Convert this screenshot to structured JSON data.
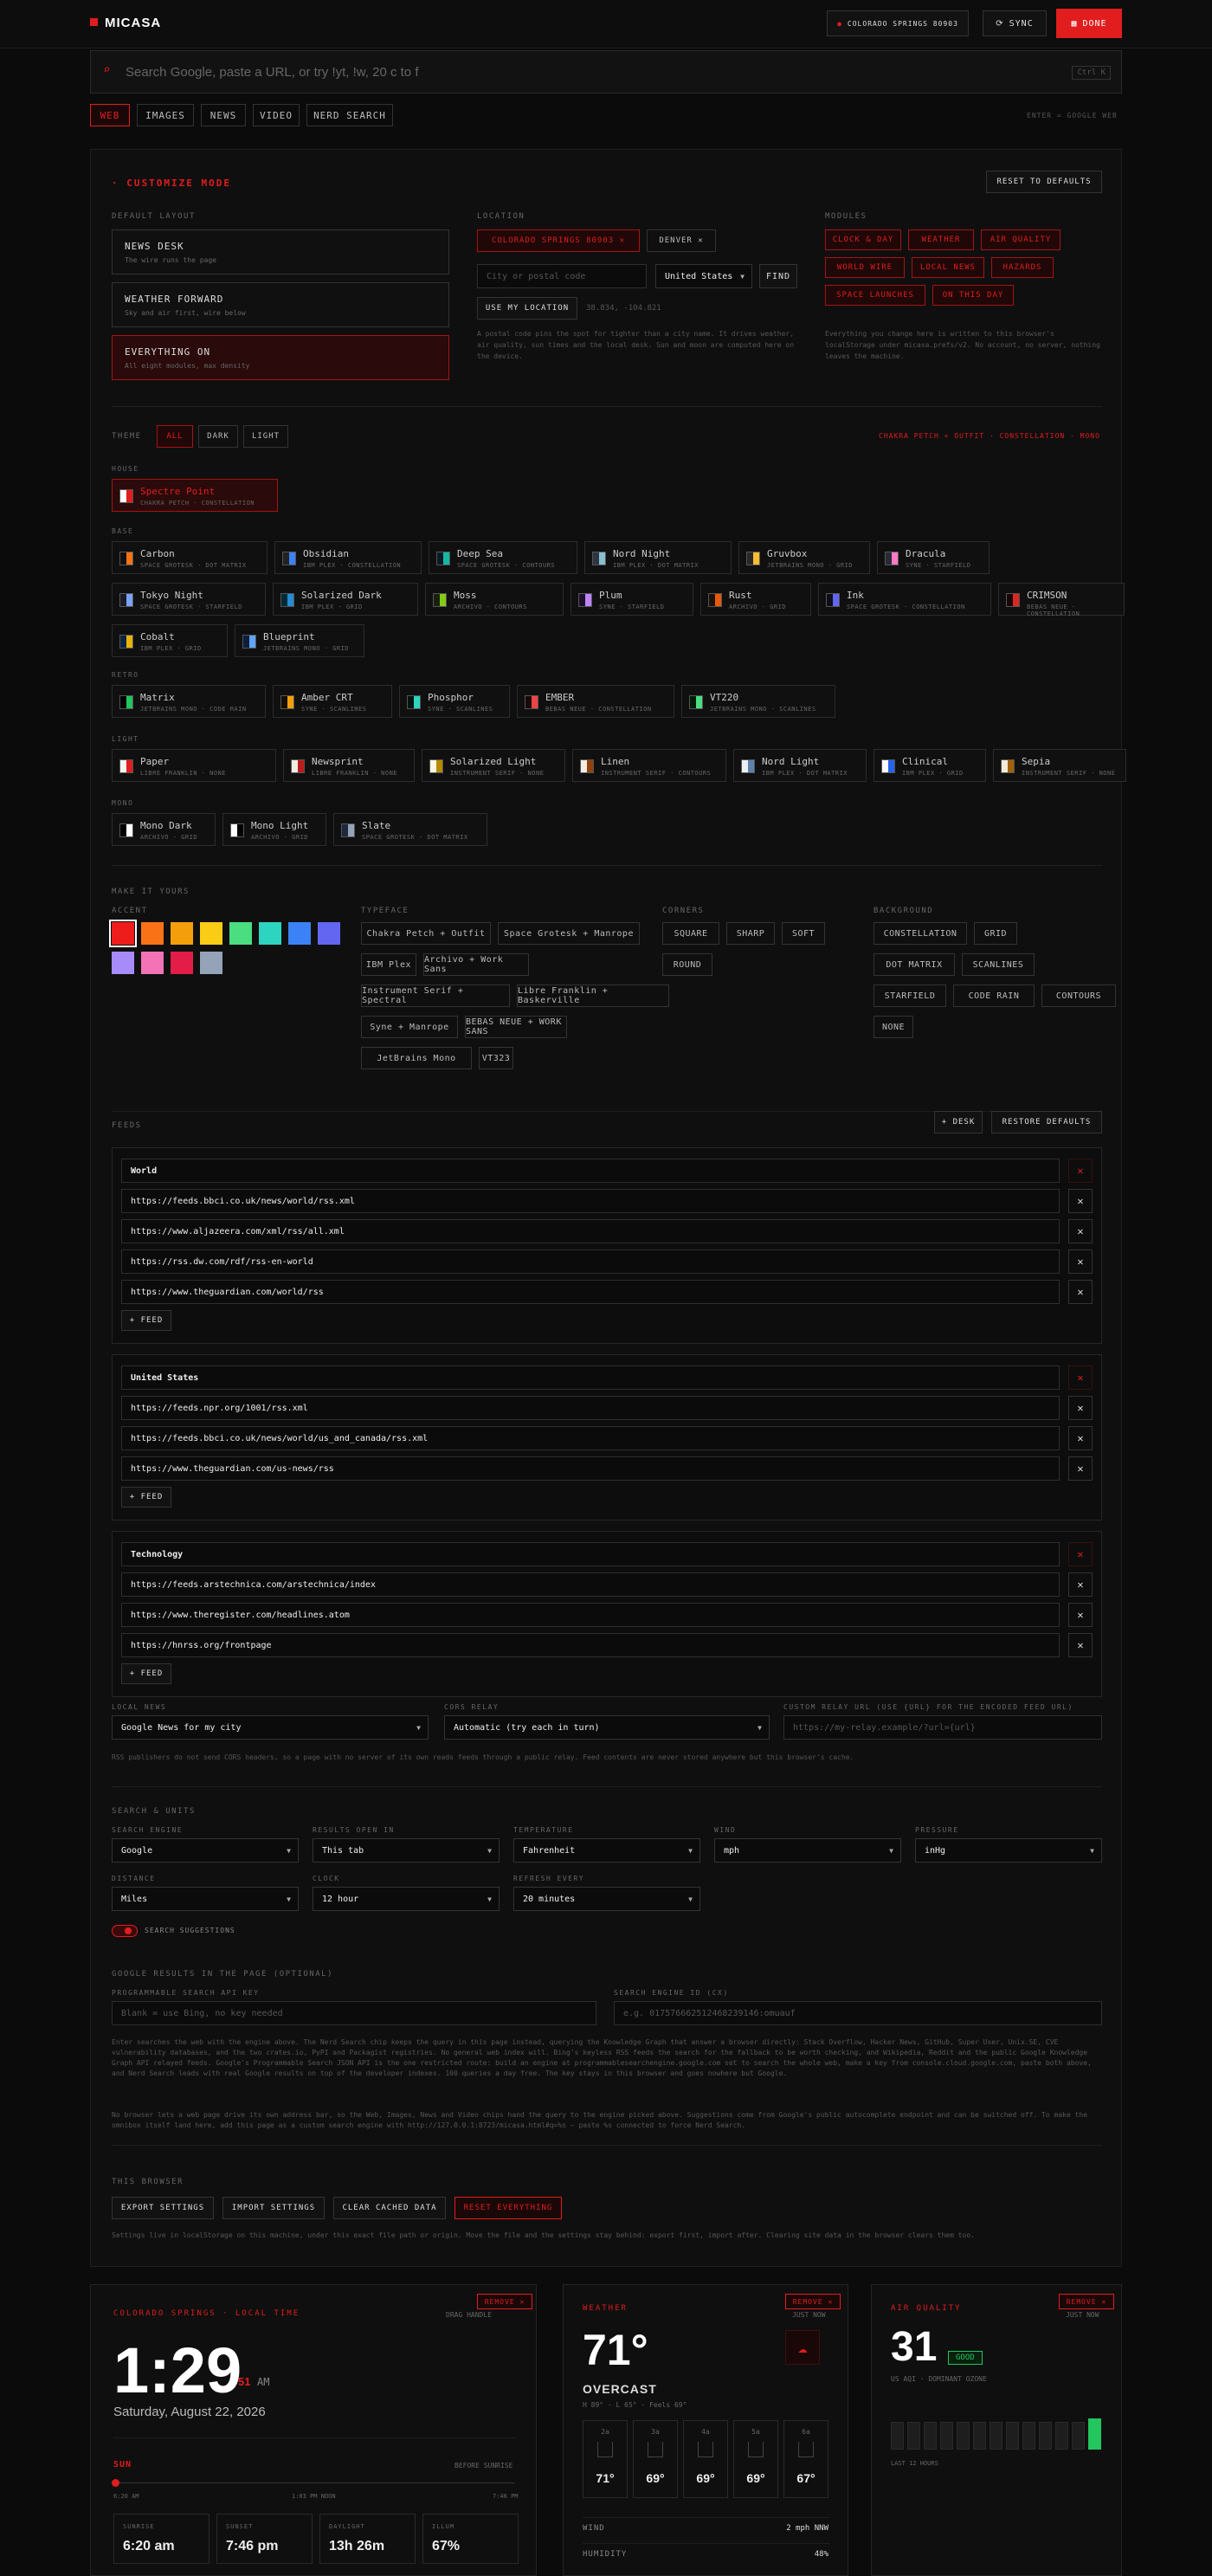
{
  "header": {
    "brand": "MICASA",
    "location": "COLORADO SPRINGS 80903",
    "sync": "SYNC",
    "done": "DONE"
  },
  "search": {
    "placeholder": "Search Google, paste a URL, or try !yt, !w, 20 c to f",
    "shortcut": "Ctrl K"
  },
  "tabs": [
    "WEB",
    "IMAGES",
    "NEWS",
    "VIDEO",
    "NERD SEARCH"
  ],
  "search_hint": "ENTER = GOOGLE WEB",
  "customize": {
    "title": "CUSTOMIZE MODE",
    "reset": "RESET TO DEFAULTS",
    "default_layout_label": "DEFAULT LAYOUT",
    "layouts": [
      {
        "title": "NEWS DESK",
        "sub": "The wire runs the page"
      },
      {
        "title": "WEATHER FORWARD",
        "sub": "Sky and air first, wire below"
      },
      {
        "title": "EVERYTHING ON",
        "sub": "All eight modules, max density"
      }
    ],
    "location_label": "LOCATION",
    "locations": [
      "COLORADO SPRINGS 80903",
      "DENVER"
    ],
    "city_placeholder": "City or postal code",
    "country": "United States",
    "find": "FIND",
    "use_location": "USE MY LOCATION",
    "coords": "38.834, -104.821",
    "location_note": "A postal code pins the spot for tighter than a city name. It drives weather, air quality, sun times and the local desk. Sun and moon are computed here on the device.",
    "modules_label": "MODULES",
    "modules": [
      "CLOCK & DAY",
      "WEATHER",
      "AIR QUALITY",
      "WORLD WIRE",
      "LOCAL NEWS",
      "HAZARDS",
      "SPACE LAUNCHES",
      "ON THIS DAY"
    ],
    "modules_note": "Everything you change here is written to this browser's localStorage under micasa.prefs/v2. No account, no server, nothing leaves the machine."
  },
  "theme": {
    "label": "THEME",
    "filters": [
      "ALL",
      "DARK",
      "LIGHT"
    ],
    "current": "CHAKRA PETCH + OUTFIT · CONSTELLATION · MONO",
    "house_label": "HOUSE",
    "house": [
      {
        "name": "Spectre Point",
        "desc": "CHAKRA PETCH · CONSTELLATION",
        "c1": "#e11d1d",
        "c2": "#ffffff"
      }
    ],
    "base_label": "BASE",
    "base": [
      {
        "name": "Carbon",
        "desc": "SPACE GROTESK · DOT MATRIX",
        "c1": "#f97316",
        "c2": "#111"
      },
      {
        "name": "Obsidian",
        "desc": "IBM PLEX · CONSTELLATION",
        "c1": "#3b82f6",
        "c2": "#222"
      },
      {
        "name": "Deep Sea",
        "desc": "SPACE GROTESK · CONTOURS",
        "c1": "#14b8a6",
        "c2": "#0c1a24"
      },
      {
        "name": "Nord Night",
        "desc": "IBM PLEX · DOT MATRIX",
        "c1": "#88c0d0",
        "c2": "#2e3440"
      },
      {
        "name": "Gruvbox",
        "desc": "JETBRAINS MONO · GRID",
        "c1": "#fabd2f",
        "c2": "#282828"
      },
      {
        "name": "Dracula",
        "desc": "SYNE · STARFIELD",
        "c1": "#ff79c6",
        "c2": "#282a36"
      },
      {
        "name": "Tokyo Night",
        "desc": "SPACE GROTESK · STARFIELD",
        "c1": "#7aa2f7",
        "c2": "#1a1b26"
      },
      {
        "name": "Solarized Dark",
        "desc": "IBM PLEX · GRID",
        "c1": "#268bd2",
        "c2": "#002b36"
      },
      {
        "name": "Moss",
        "desc": "ARCHIVO · CONTOURS",
        "c1": "#84cc16",
        "c2": "#1a2010"
      },
      {
        "name": "Plum",
        "desc": "SYNE · STARFIELD",
        "c1": "#c084fc",
        "c2": "#1e1028"
      },
      {
        "name": "Rust",
        "desc": "ARCHIVO · GRID",
        "c1": "#ea580c",
        "c2": "#1c1208"
      },
      {
        "name": "Ink",
        "desc": "SPACE GROTESK · CONSTELLATION",
        "c1": "#6366f1",
        "c2": "#0f0f1a"
      },
      {
        "name": "CRIMSON",
        "desc": "BEBAS NEUE · CONSTELLATION",
        "c1": "#dc2626",
        "c2": "#1a0606"
      },
      {
        "name": "Cobalt",
        "desc": "IBM PLEX · GRID",
        "c1": "#eab308",
        "c2": "#0b2540"
      },
      {
        "name": "Blueprint",
        "desc": "JETBRAINS MONO · GRID",
        "c1": "#60a5fa",
        "c2": "#0c1e3a"
      }
    ],
    "retro_label": "RETRO",
    "retro": [
      {
        "name": "Matrix",
        "desc": "JETBRAINS MONO · CODE RAIN",
        "c1": "#22c55e",
        "c2": "#000"
      },
      {
        "name": "Amber CRT",
        "desc": "SYNE · SCANLINES",
        "c1": "#f59e0b",
        "c2": "#140c00"
      },
      {
        "name": "Phosphor",
        "desc": "SYNE · SCANLINES",
        "c1": "#2dd4bf",
        "c2": "#001410"
      },
      {
        "name": "EMBER",
        "desc": "BEBAS NEUE · CONSTELLATION",
        "c1": "#ef4444",
        "c2": "#180808"
      },
      {
        "name": "VT220",
        "desc": "JETBRAINS MONO · SCANLINES",
        "c1": "#4ade80",
        "c2": "#031a08"
      }
    ],
    "light_label": "LIGHT",
    "light": [
      {
        "name": "Paper",
        "desc": "LIBRE FRANKLIN · NONE",
        "c1": "#e11d1d",
        "c2": "#f5f5f0"
      },
      {
        "name": "Newsprint",
        "desc": "LIBRE FRANKLIN · NONE",
        "c1": "#b91c1c",
        "c2": "#efece4"
      },
      {
        "name": "Solarized Light",
        "desc": "INSTRUMENT SERIF · NONE",
        "c1": "#b58900",
        "c2": "#fdf6e3"
      },
      {
        "name": "Linen",
        "desc": "INSTRUMENT SERIF · CONTOURS",
        "c1": "#92400e",
        "c2": "#f3ede2"
      },
      {
        "name": "Nord Light",
        "desc": "IBM PLEX · DOT MATRIX",
        "c1": "#5e81ac",
        "c2": "#eceff4"
      },
      {
        "name": "Clinical",
        "desc": "IBM PLEX · GRID",
        "c1": "#2563eb",
        "c2": "#fafafa"
      },
      {
        "name": "Sepia",
        "desc": "INSTRUMENT SERIF · NONE",
        "c1": "#a16207",
        "c2": "#f4ecd8"
      }
    ],
    "mono_label": "MONO",
    "mono": [
      {
        "name": "Mono Dark",
        "desc": "ARCHIVO · GRID",
        "c1": "#ffffff",
        "c2": "#000"
      },
      {
        "name": "Mono Light",
        "desc": "ARCHIVO · GRID",
        "c1": "#000000",
        "c2": "#fff"
      },
      {
        "name": "Slate",
        "desc": "SPACE GROTESK · DOT MATRIX",
        "c1": "#94a3b8",
        "c2": "#1e293b"
      }
    ]
  },
  "make_it_yours": {
    "label": "MAKE IT YOURS",
    "accent_label": "ACCENT",
    "accents": [
      "#ef1c1c",
      "#f97316",
      "#f59e0b",
      "#facc15",
      "#4ade80",
      "#2dd4bf",
      "#3b82f6",
      "#6366f1",
      "#a78bfa",
      "#f472b6",
      "#e11d48",
      "#94a3b8"
    ],
    "typeface_label": "TYPEFACE",
    "typefaces": [
      "Chakra Petch + Outfit",
      "Space Grotesk + Manrope",
      "IBM Plex",
      "Archivo + Work Sans",
      "Instrument Serif + Spectral",
      "Libre Franklin + Baskerville",
      "Syne + Manrope",
      "BEBAS NEUE + WORK SANS",
      "JetBrains Mono",
      "VT323"
    ],
    "corners_label": "CORNERS",
    "corners": [
      "SQUARE",
      "SHARP",
      "SOFT",
      "ROUND"
    ],
    "background_label": "BACKGROUND",
    "backgrounds": [
      "CONSTELLATION",
      "GRID",
      "DOT MATRIX",
      "SCANLINES",
      "STARFIELD",
      "CODE RAIN",
      "CONTOURS",
      "NONE"
    ]
  },
  "feeds": {
    "label": "FEEDS",
    "add_desk": "+ DESK",
    "restore": "RESTORE DEFAULTS",
    "add_feed": "+ FEED",
    "desks": [
      {
        "name": "World",
        "urls": [
          "https://feeds.bbci.co.uk/news/world/rss.xml",
          "https://www.aljazeera.com/xml/rss/all.xml",
          "https://rss.dw.com/rdf/rss-en-world",
          "https://www.theguardian.com/world/rss"
        ]
      },
      {
        "name": "United States",
        "urls": [
          "https://feeds.npr.org/1001/rss.xml",
          "https://feeds.bbci.co.uk/news/world/us_and_canada/rss.xml",
          "https://www.theguardian.com/us-news/rss"
        ]
      },
      {
        "name": "Technology",
        "urls": [
          "https://feeds.arstechnica.com/arstechnica/index",
          "https://www.theregister.com/headlines.atom",
          "https://hnrss.org/frontpage"
        ]
      }
    ],
    "local_news_label": "LOCAL NEWS",
    "local_news": "Google News for my city",
    "cors_label": "CORS RELAY",
    "cors": "Automatic (try each in turn)",
    "custom_relay_label": "CUSTOM RELAY URL (USE {URL} FOR THE ENCODED FEED URL)",
    "custom_relay_placeholder": "https://my-relay.example/?url={url}",
    "relay_note": "RSS publishers do not send CORS headers, so a page with no server of its own reads feeds through a public relay. Feed contents are never stored anywhere but this browser's cache."
  },
  "search_units": {
    "label": "SEARCH & UNITS",
    "fields": [
      {
        "label": "SEARCH ENGINE",
        "value": "Google"
      },
      {
        "label": "RESULTS OPEN IN",
        "value": "This tab"
      },
      {
        "label": "TEMPERATURE",
        "value": "Fahrenheit"
      },
      {
        "label": "WIND",
        "value": "mph"
      },
      {
        "label": "PRESSURE",
        "value": "inHg"
      },
      {
        "label": "DISTANCE",
        "value": "Miles"
      },
      {
        "label": "CLOCK",
        "value": "12 hour"
      },
      {
        "label": "REFRESH EVERY",
        "value": "20 minutes"
      }
    ],
    "suggestions": "SEARCH SUGGESTIONS",
    "google_label": "GOOGLE RESULTS IN THE PAGE (OPTIONAL)",
    "pse_label": "PROGRAMMABLE SEARCH API KEY",
    "pse_placeholder": "Blank = use Bing, no key needed",
    "cx_label": "SEARCH ENGINE ID (CX)",
    "cx_placeholder": "e.g. 017576662512468239146:omuauf",
    "note1": "Enter searches the web with the engine above. The Nerd Search chip keeps the query in this page instead, querying the Knowledge Graph that answer a browser directly: Stack Overflow, Hacker News, GitHub, Super User, Unix.SE, CVE vulnerability databases, and the two crates.io, PyPI and Packagist registries. No general web index will. Bing's keyless RSS feeds the search for the fallback to be worth checking, and Wikipedia, Reddit and the public Google Knowledge Graph API relayed feeds. Google's Programmable Search JSON API is the one restricted route: build an engine at programmablesearchengine.google.com set to search the whole web, make a key from console.cloud.google.com, paste both above, and Nerd Search leads with real Google results on top of the developer indexes. 100 queries a day free. The key stays in this browser and goes nowhere but Google.",
    "note2": "No browser lets a web page drive its own address bar, so the Web, Images, News and Video chips hand the query to the engine picked above. Suggestions come from Google's public autocomplete endpoint and can be switched off. To make the omnibox itself land here, add this page as a custom search engine with http://127.0.0.1:8723/micasa.html#q=%s — paste %s connected to force Nerd Search."
  },
  "browser": {
    "label": "THIS BROWSER",
    "actions": [
      "EXPORT SETTINGS",
      "IMPORT SETTINGS",
      "CLEAR CACHED DATA",
      "RESET EVERYTHING"
    ],
    "note": "Settings live in localStorage on this machine, under this exact file path or origin. Move the file and the settings stay behind: export first, import after. Clearing site data in the browser clears them too."
  },
  "widgets": {
    "clock": {
      "title": "COLORADO SPRINGS · LOCAL TIME",
      "remove": "REMOVE ✕",
      "drag": "DRAG HANDLE",
      "time": "1:29",
      "sec": "51",
      "ampm": "AM",
      "date": "Saturday, August 22, 2026",
      "sun_label": "SUN",
      "sun_state": "BEFORE SUNRISE",
      "sun_left": "6:20 AM",
      "sun_mid": "1:03 PM NOON",
      "sun_right": "7:46 PM",
      "stats": [
        {
          "k": "SUNRISE",
          "v": "6:20 am"
        },
        {
          "k": "SUNSET",
          "v": "7:46 pm"
        },
        {
          "k": "DAYLIGHT",
          "v": "13h 26m"
        },
        {
          "k": "ILLUM",
          "v": "67%"
        }
      ]
    },
    "weather": {
      "title": "WEATHER",
      "remove": "REMOVE ✕",
      "drag": "JUST NOW",
      "temp": "71°",
      "cond": "OVERCAST",
      "hilo": "H 89° · L 65° · Feels 69°",
      "forecast": [
        {
          "h": "2a",
          "v": "71°"
        },
        {
          "h": "3a",
          "v": "69°"
        },
        {
          "h": "4a",
          "v": "69°"
        },
        {
          "h": "5a",
          "v": "69°"
        },
        {
          "h": "6a",
          "v": "67°"
        }
      ],
      "rows": [
        {
          "k": "WIND",
          "v": "2 mph NNW"
        },
        {
          "k": "HUMIDITY",
          "v": "48%"
        }
      ]
    },
    "air": {
      "title": "AIR QUALITY",
      "remove": "REMOVE ✕",
      "drag": "JUST NOW",
      "aqi": "31",
      "badge": "GOOD",
      "detail": "US AQI · DOMINANT OZONE",
      "history": "LAST 12 HOURS",
      "bars": [
        0.55,
        0.55,
        0.55,
        0.55,
        0.55,
        0.55,
        0.55,
        0.55,
        0.55,
        0.55,
        0.55,
        0.55,
        0.62
      ]
    }
  }
}
